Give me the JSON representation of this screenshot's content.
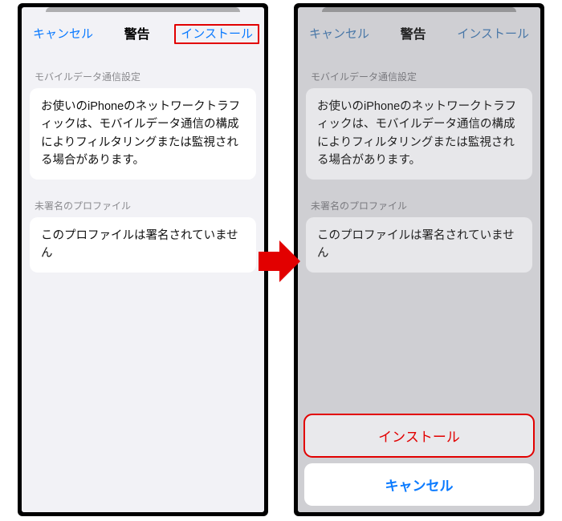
{
  "colors": {
    "ios_blue": "#0a7aff",
    "highlight_red": "#e20000"
  },
  "left": {
    "nav": {
      "cancel": "キャンセル",
      "title": "警告",
      "install": "インストール"
    },
    "section1": {
      "label": "モバイルデータ通信設定",
      "body": "お使いのiPhoneのネットワークトラフィックは、モバイルデータ通信の構成によりフィルタリングまたは監視される場合があります。"
    },
    "section2": {
      "label": "未署名のプロファイル",
      "body": "このプロファイルは署名されていません"
    }
  },
  "right": {
    "nav": {
      "cancel": "キャンセル",
      "title": "警告",
      "install": "インストール"
    },
    "section1": {
      "label": "モバイルデータ通信設定",
      "body": "お使いのiPhoneのネットワークトラフィックは、モバイルデータ通信の構成によりフィルタリングまたは監視される場合があります。"
    },
    "section2": {
      "label": "未署名のプロファイル",
      "body": "このプロファイルは署名されていません"
    },
    "sheet": {
      "install": "インストール",
      "cancel": "キャンセル"
    }
  }
}
